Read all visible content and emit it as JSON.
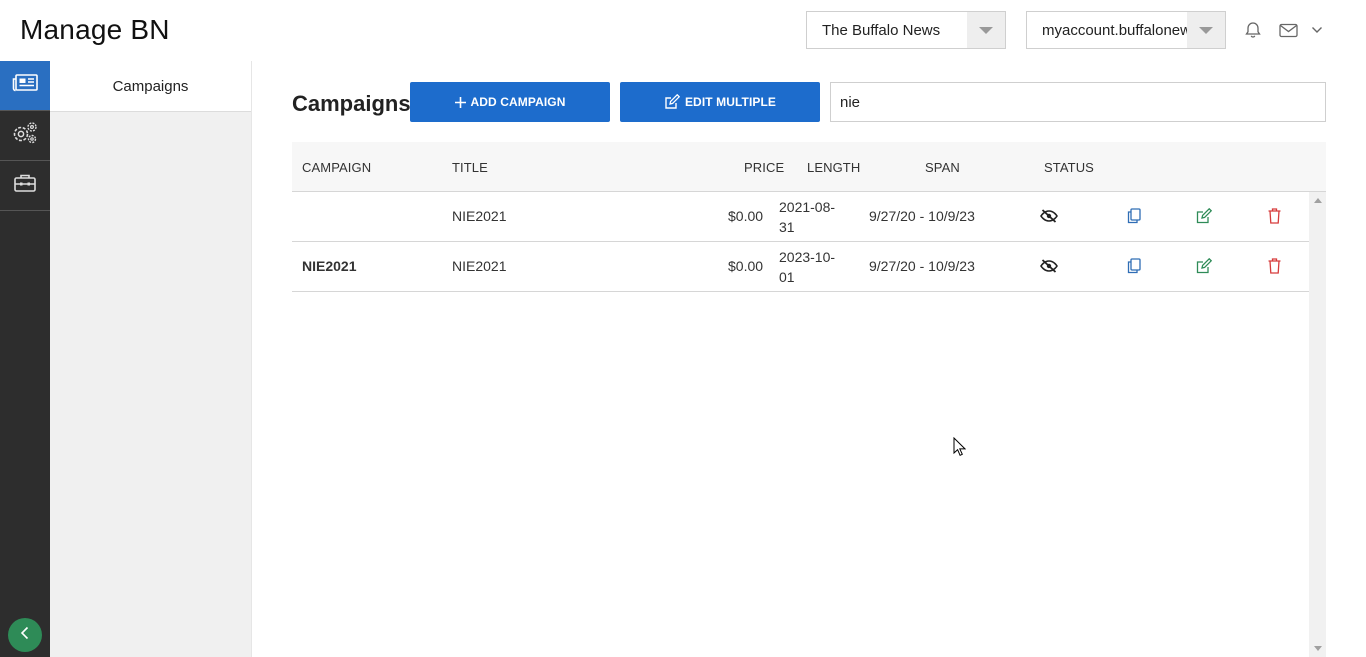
{
  "header": {
    "title": "Manage BN",
    "publication_select": {
      "value": "The Buffalo News"
    },
    "account_select": {
      "value": "myaccount.buffalonews.com"
    },
    "icons": [
      "bell-icon",
      "envelope-icon",
      "chevron-down-icon"
    ]
  },
  "rail": {
    "items": [
      {
        "name": "newspaper-icon",
        "active": true
      },
      {
        "name": "gears-icon",
        "active": false
      },
      {
        "name": "toolbox-icon",
        "active": false
      }
    ],
    "collapse_icon": "chevron-left-icon",
    "active_color": "#2a6fc1",
    "collapse_color": "#2e8b57"
  },
  "subnav": {
    "items": [
      {
        "label": "Campaigns"
      }
    ]
  },
  "main": {
    "title": "Campaigns",
    "add_button": {
      "label": "ADD CAMPAIGN",
      "icon": "plus-icon"
    },
    "edit_button": {
      "label": "EDIT MULTIPLE",
      "icon": "edit-icon"
    },
    "search": {
      "value": "nie"
    },
    "accent_color": "#1d6ccc"
  },
  "table": {
    "columns": {
      "campaign": "CAMPAIGN",
      "title": "TITLE",
      "price": "PRICE",
      "length": "LENGTH",
      "span": "SPAN",
      "status": "STATUS"
    },
    "rows": [
      {
        "campaign": "",
        "title": "NIE2021",
        "price": "$0.00",
        "length": "2021-08-31",
        "span": "9/27/20 - 10/9/23",
        "status_icon": "eye-slash-icon",
        "actions": [
          "copy-icon",
          "edit-icon",
          "trash-icon"
        ]
      },
      {
        "campaign": "NIE2021",
        "title": "NIE2021",
        "price": "$0.00",
        "length": "2023-10-01",
        "span": "9/27/20 - 10/9/23",
        "status_icon": "eye-slash-icon",
        "actions": [
          "copy-icon",
          "edit-icon",
          "trash-icon"
        ]
      }
    ]
  }
}
